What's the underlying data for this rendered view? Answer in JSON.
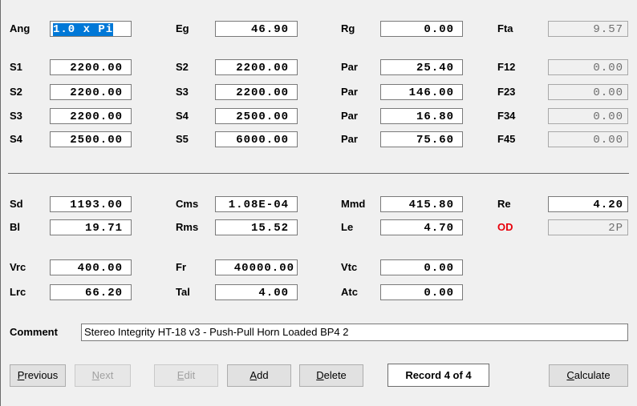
{
  "top_row": {
    "ang_label": "Ang",
    "ang_value": "1.0 x Pi",
    "eg_label": "Eg",
    "eg_value": "46.90",
    "rg_label": "Rg",
    "rg_value": "0.00",
    "fta_label": "Fta",
    "fta_value": "9.57"
  },
  "segments": [
    {
      "a_label": "S1",
      "a_value": "2200.00",
      "b_label": "S2",
      "b_value": "2200.00",
      "par_label": "Par",
      "par_value": "25.40",
      "f_label": "F12",
      "f_value": "0.00"
    },
    {
      "a_label": "S2",
      "a_value": "2200.00",
      "b_label": "S3",
      "b_value": "2200.00",
      "par_label": "Par",
      "par_value": "146.00",
      "f_label": "F23",
      "f_value": "0.00"
    },
    {
      "a_label": "S3",
      "a_value": "2200.00",
      "b_label": "S4",
      "b_value": "2500.00",
      "par_label": "Par",
      "par_value": "16.80",
      "f_label": "F34",
      "f_value": "0.00"
    },
    {
      "a_label": "S4",
      "a_value": "2500.00",
      "b_label": "S5",
      "b_value": "6000.00",
      "par_label": "Par",
      "par_value": "75.60",
      "f_label": "F45",
      "f_value": "0.00"
    }
  ],
  "driver": {
    "sd_label": "Sd",
    "sd_value": "1193.00",
    "cms_label": "Cms",
    "cms_value": "1.08E-04",
    "mmd_label": "Mmd",
    "mmd_value": "415.80",
    "re_label": "Re",
    "re_value": "4.20",
    "bl_label": "Bl",
    "bl_value": "19.71",
    "rms_label": "Rms",
    "rms_value": "15.52",
    "le_label": "Le",
    "le_value": "4.70",
    "od_label": "OD",
    "od_value": "2P",
    "vrc_label": "Vrc",
    "vrc_value": "400.00",
    "fr_label": "Fr",
    "fr_value": "40000.00",
    "vtc_label": "Vtc",
    "vtc_value": "0.00",
    "lrc_label": "Lrc",
    "lrc_value": "66.20",
    "tal_label": "Tal",
    "tal_value": "4.00",
    "atc_label": "Atc",
    "atc_value": "0.00"
  },
  "comment": {
    "label": "Comment",
    "value": "Stereo Integrity HT-18 v3 - Push-Pull Horn Loaded BP4 2"
  },
  "buttons": {
    "previous": {
      "u": "P",
      "rest": "revious"
    },
    "next": {
      "u": "N",
      "rest": "ext"
    },
    "edit": {
      "u": "E",
      "rest": "dit"
    },
    "add": {
      "u": "A",
      "rest": "dd"
    },
    "delete": {
      "u": "D",
      "rest": "elete"
    },
    "calculate": {
      "u": "C",
      "rest": "alculate"
    }
  },
  "record_status": "Record 4 of 4",
  "colors": {
    "od_label": "#e8000b",
    "selection": "#0078d7"
  }
}
